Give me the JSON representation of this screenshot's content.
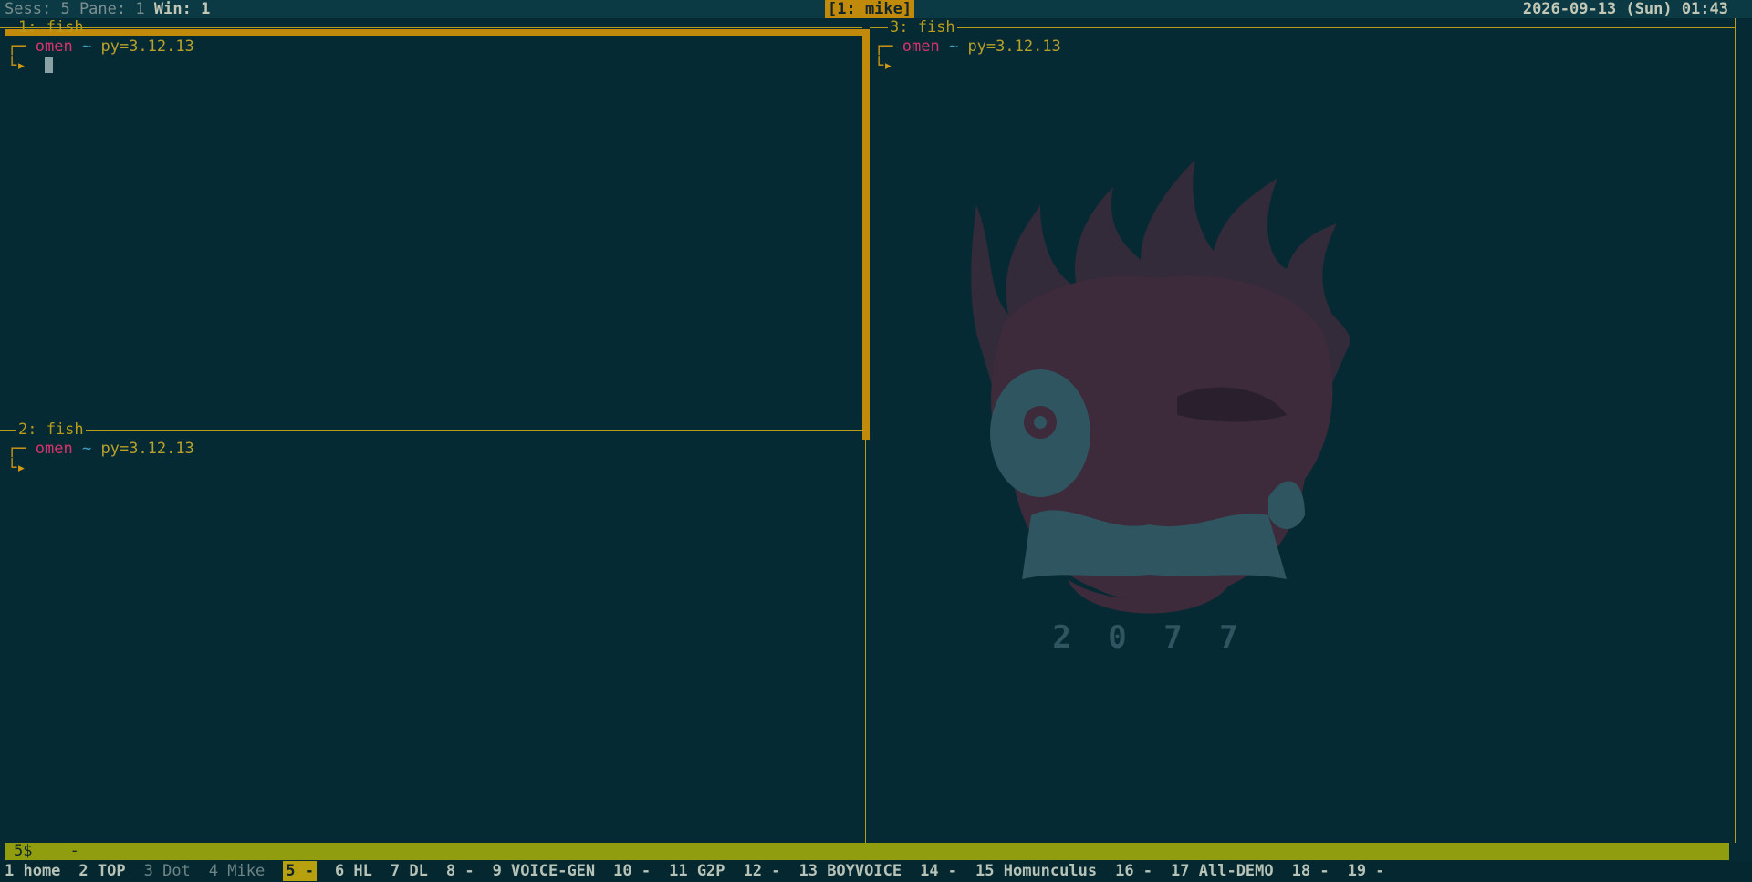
{
  "topbar": {
    "sess_label": "Sess:",
    "sess_value": "5",
    "pane_label": "Pane:",
    "pane_value": "1",
    "win_label": "Win:",
    "win_value": "1",
    "session_name": "[1: mike]",
    "datetime": "2026-09-13 (Sun) 01:43"
  },
  "panes": [
    {
      "title": "1: fish",
      "host": "omen",
      "tilde": "~",
      "python": "py=3.12.13",
      "corner_top": "┌─",
      "corner_bottom": "└▸",
      "active": true
    },
    {
      "title": "2: fish",
      "host": "omen",
      "tilde": "~",
      "python": "py=3.12.13",
      "corner_top": "┌─",
      "corner_bottom": "└▸",
      "active": false
    },
    {
      "title": "3: fish",
      "host": "omen",
      "tilde": "~",
      "python": "py=3.12.13",
      "corner_top": "┌─",
      "corner_bottom": "└▸",
      "active": false
    }
  ],
  "wallpaper": {
    "year_text": "2 0 7 7"
  },
  "cmdbar": {
    "session_status": "5$",
    "separator": "-"
  },
  "windows": [
    {
      "label": "1 home",
      "state": "normal"
    },
    {
      "label": "2 TOP",
      "state": "normal"
    },
    {
      "label": "3 Dot",
      "state": "dim"
    },
    {
      "label": "4 Mike",
      "state": "dim"
    },
    {
      "label": "5 -",
      "state": "current"
    },
    {
      "label": "6 HL",
      "state": "normal"
    },
    {
      "label": "7 DL",
      "state": "normal"
    },
    {
      "label": "8 -",
      "state": "normal"
    },
    {
      "label": "9 VOICE-GEN",
      "state": "normal"
    },
    {
      "label": "10 -",
      "state": "normal"
    },
    {
      "label": "11 G2P",
      "state": "normal"
    },
    {
      "label": "12 -",
      "state": "normal"
    },
    {
      "label": "13 BOYVOICE",
      "state": "normal"
    },
    {
      "label": "14 -",
      "state": "normal"
    },
    {
      "label": "15 Homunculus",
      "state": "normal"
    },
    {
      "label": "16 -",
      "state": "normal"
    },
    {
      "label": "17 All-DEMO",
      "state": "normal"
    },
    {
      "label": "18 -",
      "state": "normal"
    },
    {
      "label": "19 -",
      "state": "normal"
    }
  ],
  "colors": {
    "background": "#062a33",
    "pane_border": "#b79d1a",
    "active_border": "#c28a0a",
    "host": "#d6336c",
    "python": "#b7a12a",
    "status_bar": "#8f9d0f"
  }
}
